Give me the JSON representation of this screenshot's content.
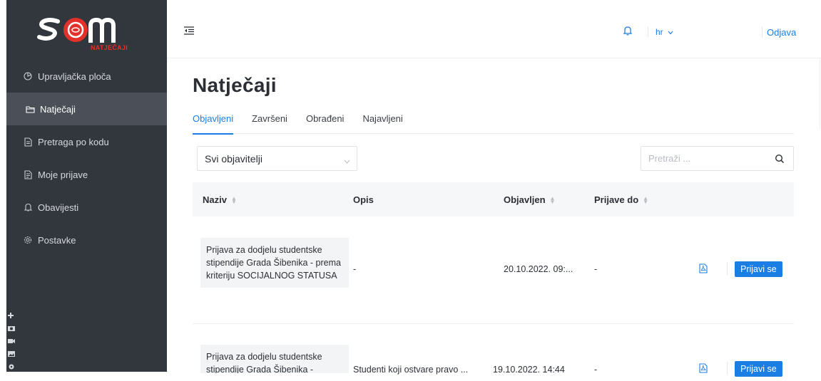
{
  "logo": {
    "text": "NATJEČAJI",
    "brand_color": "#e2302a"
  },
  "sidebar": {
    "items": [
      {
        "label": "Upravljačka ploča",
        "icon": "dashboard-icon",
        "active": false
      },
      {
        "label": "Natječaji",
        "icon": "folder-icon",
        "active": true
      },
      {
        "label": "Pretraga po kodu",
        "icon": "file-search-icon",
        "active": false
      },
      {
        "label": "Moje prijave",
        "icon": "file-list-icon",
        "active": false
      },
      {
        "label": "Obavijesti",
        "icon": "bell-icon",
        "active": false
      },
      {
        "label": "Postavke",
        "icon": "gear-icon",
        "active": false
      }
    ]
  },
  "header": {
    "language": "hr",
    "logout_label": "Odjava",
    "accent": "#1a7ee4"
  },
  "main": {
    "title": "Natječaji",
    "tabs": [
      {
        "label": "Objavljeni",
        "active": true
      },
      {
        "label": "Završeni",
        "active": false
      },
      {
        "label": "Obrađeni",
        "active": false
      },
      {
        "label": "Najavljeni",
        "active": false
      }
    ],
    "publisher_select": {
      "value": "Svi objavitelji"
    },
    "search": {
      "placeholder": "Pretraži ..."
    },
    "table": {
      "columns": [
        "Naziv",
        "Opis",
        "Objavljen",
        "Prijave do"
      ],
      "rows": [
        {
          "name": "Prijava za dodjelu studentske stipendije Grada Šibenika - prema kriteriju SOCIJALNOG STATUSA",
          "description": "-",
          "published": "20.10.2022. 09:...",
          "deadline": "-",
          "action": "Prijavi se"
        },
        {
          "name": "Prijava za dodjelu studentske stipendije Grada Šibenika -",
          "description": "Studenti koji ostvare pravo ...",
          "published": "19.10.2022. 14:44",
          "deadline": "-",
          "action": "Prijavi se"
        }
      ]
    }
  }
}
